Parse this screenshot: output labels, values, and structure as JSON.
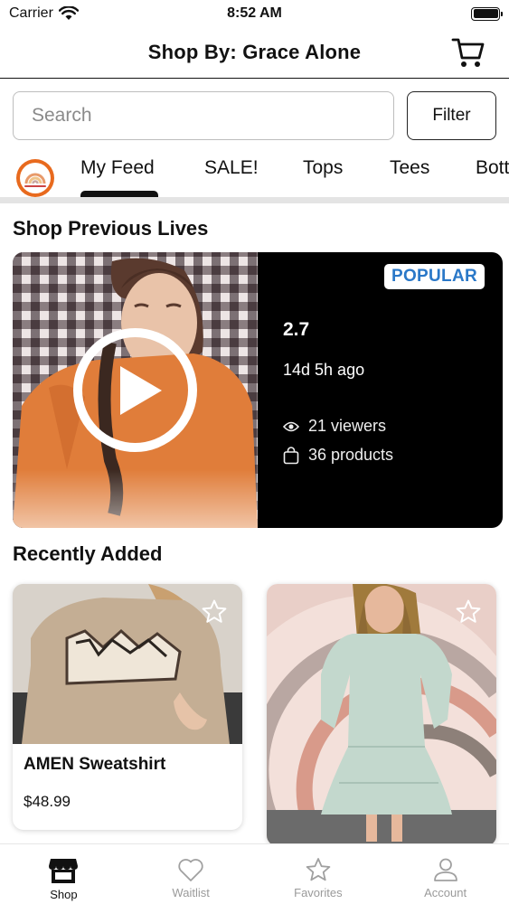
{
  "status_bar": {
    "carrier": "Carrier",
    "time": "8:52 AM"
  },
  "header": {
    "title": "Shop By: Grace Alone"
  },
  "search": {
    "placeholder": "Search",
    "value": ""
  },
  "filter": {
    "label": "Filter"
  },
  "tabs": [
    {
      "label": "My Feed",
      "active": true
    },
    {
      "label": "SALE!"
    },
    {
      "label": "Tops"
    },
    {
      "label": "Tees"
    },
    {
      "label": "Bott"
    }
  ],
  "sections": {
    "previous_lives": "Shop Previous Lives",
    "recently_added": "Recently Added"
  },
  "live": {
    "badge": "POPULAR",
    "name": "2.7",
    "time_ago": "14d 5h ago",
    "viewers": "21 viewers",
    "products": "36 products"
  },
  "products": [
    {
      "name": "AMEN Sweatshirt",
      "price": "$48.99"
    },
    {
      "name": "",
      "price": ""
    }
  ],
  "nav": [
    {
      "label": "Shop",
      "icon": "store-icon",
      "active": true
    },
    {
      "label": "Waitlist",
      "icon": "heart-icon"
    },
    {
      "label": "Favorites",
      "icon": "star-icon"
    },
    {
      "label": "Account",
      "icon": "person-icon"
    }
  ],
  "colors": {
    "badge_text": "#2a78c8",
    "logo_ring": "#e86a1e",
    "live_panel": "#000000"
  }
}
